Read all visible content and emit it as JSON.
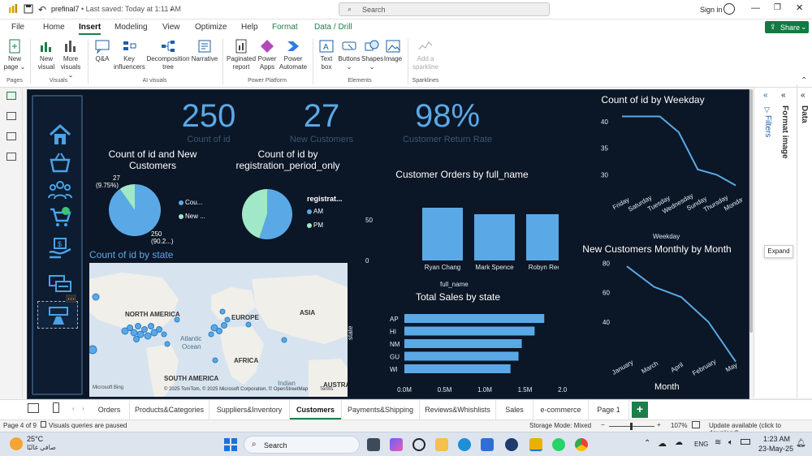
{
  "window": {
    "file_name": "prefinal7",
    "save_status": "Last saved: Today at 1:11 AM",
    "search_placeholder": "Search",
    "sign_in": "Sign in"
  },
  "menu": {
    "items": [
      "File",
      "Home",
      "Insert",
      "Modeling",
      "View",
      "Optimize",
      "Help",
      "Format",
      "Data / Drill"
    ],
    "active": "Insert",
    "share_label": "Share"
  },
  "ribbon": {
    "buttons": [
      {
        "id": "new-page",
        "label1": "New",
        "label2": "page"
      },
      {
        "id": "new-visual",
        "label1": "New",
        "label2": "visual"
      },
      {
        "id": "more-visuals",
        "label1": "More",
        "label2": "visuals"
      },
      {
        "id": "qa",
        "label1": "Q&A",
        "label2": ""
      },
      {
        "id": "key-influencers",
        "label1": "Key",
        "label2": "influencers"
      },
      {
        "id": "decomposition-tree",
        "label1": "Decomposition",
        "label2": "tree"
      },
      {
        "id": "narrative",
        "label1": "Narrative",
        "label2": ""
      },
      {
        "id": "paginated-report",
        "label1": "Paginated",
        "label2": "report"
      },
      {
        "id": "power-apps",
        "label1": "Power",
        "label2": "Apps"
      },
      {
        "id": "power-automate",
        "label1": "Power",
        "label2": "Automate"
      },
      {
        "id": "text-box",
        "label1": "Text",
        "label2": "box"
      },
      {
        "id": "buttons",
        "label1": "Buttons",
        "label2": ""
      },
      {
        "id": "shapes",
        "label1": "Shapes",
        "label2": ""
      },
      {
        "id": "image",
        "label1": "Image",
        "label2": ""
      },
      {
        "id": "add-sparkline",
        "label1": "Add a",
        "label2": "sparkline"
      }
    ],
    "groups": [
      "Pages",
      "Visuals",
      "AI visuals",
      "Power Platform",
      "Elements",
      "Sparklines"
    ]
  },
  "kpis": [
    {
      "value": "250",
      "label": "Count of id"
    },
    {
      "value": "27",
      "label": "New Customers"
    },
    {
      "value": "98%",
      "label": "Customer Return Rate"
    }
  ],
  "pie1": {
    "title_line1": "Count of id and New",
    "title_line2": "Customers",
    "label_small_1": "27",
    "label_small_2": "(9.75%)",
    "label_large_1": "250",
    "label_large_2": "(90.2...)",
    "legend": [
      "Cou...",
      "New ..."
    ]
  },
  "pie2": {
    "title_line1": "Count of id by",
    "title_line2": "registration_period_only",
    "legend_title": "registrat...",
    "legend": [
      "AM",
      "PM"
    ]
  },
  "map": {
    "title": "Count of id by state",
    "labels": [
      "NORTH AMERICA",
      "EUROPE",
      "ASIA",
      "Atlantic",
      "Ocean",
      "AFRICA",
      "SOUTH AMERICA",
      "Indian",
      "AUSTRA"
    ],
    "copyright": "© 2025 TomTom, © 2025 Microsoft Corporation, © OpenStreetMap",
    "terms": "Terms",
    "brand": "Microsoft Bing"
  },
  "visual_titles": {
    "orders": "Customer Orders by full_name",
    "sales": "Total Sales by state",
    "weekday": "Count of id by Weekday",
    "monthly": "New Customers Monthly by Month"
  },
  "axis_titles": {
    "orders_x": "full_name",
    "sales_y": "state",
    "weekday_x": "Weekday",
    "monthly_x": "Month"
  },
  "chart_data": [
    {
      "type": "pie",
      "title": "Count of id and New Customers",
      "categories": [
        "Count of id",
        "New Customers"
      ],
      "values": [
        250,
        27
      ],
      "colors": [
        "#5aa9e6",
        "#a0e8c8"
      ]
    },
    {
      "type": "pie",
      "title": "Count of id by registration_period_only",
      "categories": [
        "AM",
        "PM"
      ],
      "values": [
        55,
        45
      ],
      "colors": [
        "#5aa9e6",
        "#a0e8c8"
      ]
    },
    {
      "type": "bar",
      "title": "Customer Orders by full_name",
      "categories": [
        "Ryan Chang",
        "Mark Spence",
        "Robyn Reed"
      ],
      "values": [
        65,
        57,
        57
      ],
      "yticks": [
        "0",
        "50"
      ],
      "ylim": [
        0,
        85
      ],
      "color": "#5aa9e6"
    },
    {
      "type": "bar",
      "orientation": "horizontal",
      "title": "Total Sales by state",
      "categories": [
        "AP",
        "HI",
        "NM",
        "GU",
        "WI"
      ],
      "values": [
        1740000,
        1620000,
        1460000,
        1420000,
        1320000
      ],
      "xticks": [
        "0.0M",
        "0.5M",
        "1.0M",
        "1.5M",
        "2.0M"
      ],
      "xlim": [
        0,
        2000000
      ],
      "color": "#5aa9e6"
    },
    {
      "type": "line",
      "title": "Count of id by Weekday",
      "categories": [
        "Friday",
        "Saturday",
        "Tuesday",
        "Wednesday",
        "Sunday",
        "Thursday",
        "Monday"
      ],
      "values": [
        41,
        41,
        41,
        38,
        31,
        30,
        28
      ],
      "yticks": [
        "30",
        "35",
        "40"
      ],
      "ylim": [
        27,
        42
      ],
      "color": "#5aa9e6"
    },
    {
      "type": "line",
      "title": "New Customers Monthly by Month",
      "categories": [
        "January",
        "March",
        "April",
        "February",
        "May"
      ],
      "values": [
        78,
        64,
        57,
        40,
        13
      ],
      "yticks": [
        "40",
        "60",
        "80"
      ],
      "ylim": [
        20,
        82
      ],
      "color": "#5aa9e6"
    }
  ],
  "right_panes": {
    "filters": "Filters",
    "format_image": "Format image",
    "data": "Data",
    "tooltip": "Expand"
  },
  "tabs": {
    "items": [
      "Orders",
      "Products&Categories",
      "Suppliers&Inventory",
      "Customers",
      "Payments&Shipping",
      "Reviews&Whishlists",
      "Sales",
      "e-commerce",
      "Page 1"
    ],
    "active": "Customers",
    "add_label": "+"
  },
  "status": {
    "page": "Page 4 of 9",
    "queries": "Visuals queries are paused",
    "storage": "Storage Mode: Mixed",
    "zoom": "107%",
    "update": "Update available (click to download)"
  },
  "taskbar": {
    "temp": "25°C",
    "weather": "صافي غالبًا",
    "search": "Search",
    "lang": "ENG",
    "time": "1:23 AM",
    "date": "23-May-25"
  }
}
